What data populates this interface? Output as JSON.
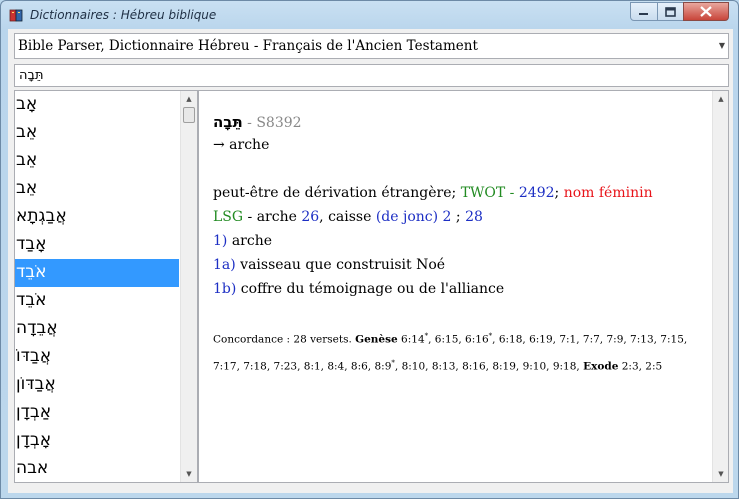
{
  "window": {
    "title": "Dictionnaires : Hébreu biblique",
    "minimize_icon": "minimize-icon",
    "maximize_icon": "maximize-icon",
    "close_icon": "close-icon",
    "app_icon": "book-icon"
  },
  "dictionary_select": {
    "value": "Bible Parser, Dictionnaire Hébreu - Français de l'Ancien Testament"
  },
  "search": {
    "value": "תֵּבָה"
  },
  "word_list": {
    "items": [
      "אָב",
      "אֵב",
      "אֵב",
      "אֵב",
      "אֲבַגְתָא",
      "אָבַד",
      "אֹבֵד",
      "אֹבֵד",
      "אֲבֵדָה",
      "אֲבַדּוֹ",
      "אֲבַדּוֹן",
      "אַבְדָן",
      "אָבְדָן",
      "אבה"
    ],
    "selected_index": 6
  },
  "entry": {
    "word": "תֵּבָה",
    "separator": " - ",
    "strong": "S8392",
    "gloss": "→ arche",
    "origin_text": "peut-être de dérivation étrangère; ",
    "twot_label": "TWOT",
    "twot_sep": " - ",
    "twot_number": "2492",
    "semicolon": "; ",
    "pos": "nom féminin",
    "lsg_label": "LSG",
    "lsg_rest_1": " - arche ",
    "lsg_count_1": "26",
    "lsg_rest_2": ", caisse ",
    "lsg_note": "(de jonc)",
    "lsg_count_2": " 2",
    "lsg_rest_3": " ; ",
    "lsg_total": "28",
    "def1_num": "1)",
    "def1_text": " arche",
    "def1a_num": "1a)",
    "def1a_text": " vaisseau que construisit Noé",
    "def1b_num": "1b)",
    "def1b_text": " coffre du témoignage ou de l'alliance"
  },
  "concordance": {
    "intro": "Concordance : 28 versets. ",
    "book1": "Genèse",
    "refs1": " 6:14",
    "sup1": "*",
    "refs1b": ", 6:15, 6:16",
    "sup2": "*",
    "refs1c": ", 6:18, 6:19, 7:1, 7:7, 7:9, 7:13, 7:15, 7:17, 7:18, 7:23, 8:1, 8:4, 8:6, 8:9",
    "sup3": "*",
    "refs1d": ", 8:10, 8:13, 8:16, 8:19, 9:10, 9:18, ",
    "book2": "Exode",
    "refs2": " 2:3, 2:5"
  }
}
